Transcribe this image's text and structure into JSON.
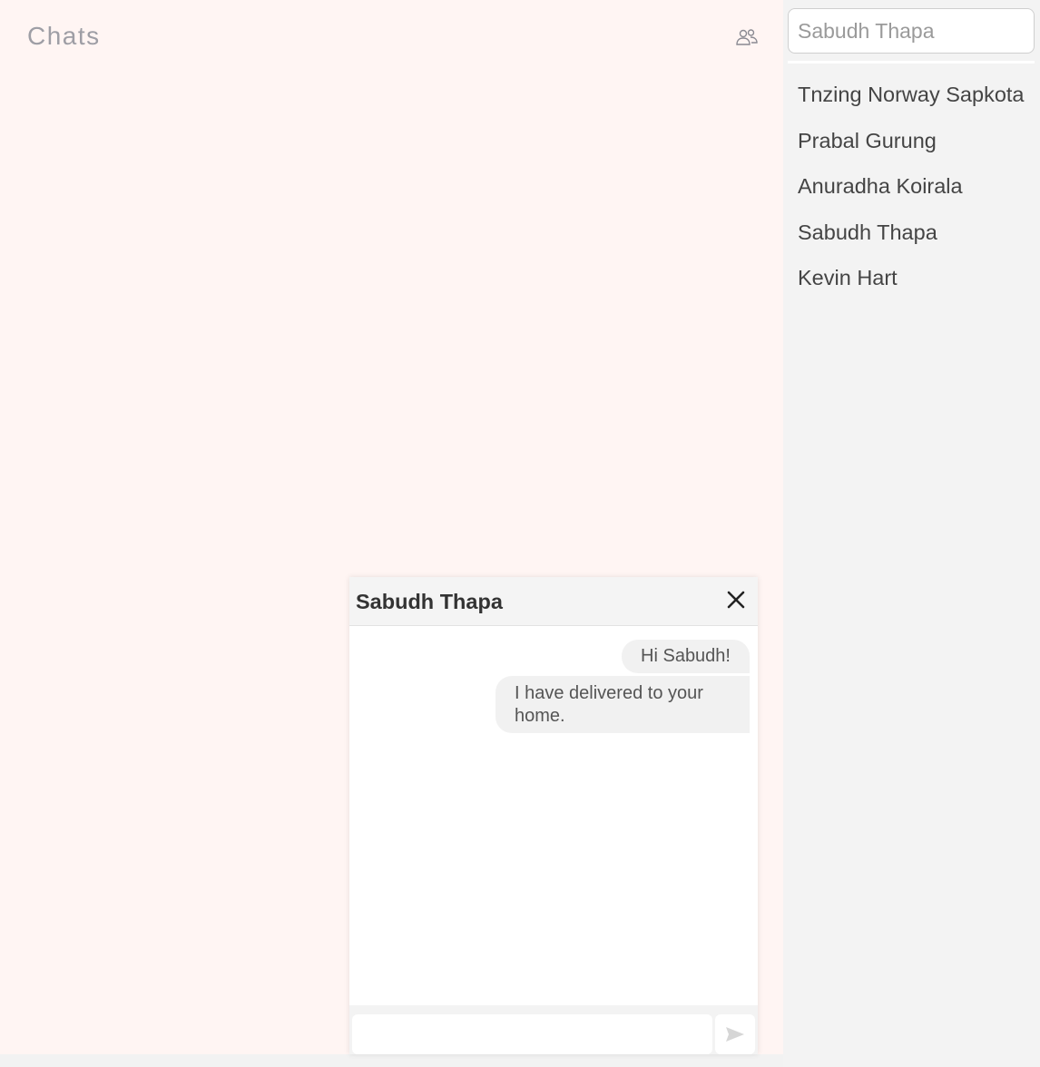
{
  "header": {
    "title": "Chats",
    "group_icon": "people-group-icon"
  },
  "sidebar": {
    "search": {
      "placeholder": "Sabudh Thapa",
      "value": ""
    },
    "contacts": [
      {
        "name": "Tnzing Norway Sapkota"
      },
      {
        "name": "Prabal Gurung"
      },
      {
        "name": "Anuradha Koirala"
      },
      {
        "name": "Sabudh Thapa"
      },
      {
        "name": "Kevin Hart"
      }
    ]
  },
  "chat": {
    "title": "Sabudh Thapa",
    "close_icon": "close-icon",
    "messages": [
      {
        "text": "Hi Sabudh!",
        "from": "me"
      },
      {
        "text": "I have delivered to your home.",
        "from": "me"
      }
    ],
    "composer": {
      "value": "",
      "send_icon": "send-icon"
    }
  },
  "colors": {
    "main_bg": "#fff5f3",
    "sidebar_bg": "#f3f3f3",
    "bubble_bg": "#f1f1f1",
    "muted_text": "#9e9ea5"
  }
}
